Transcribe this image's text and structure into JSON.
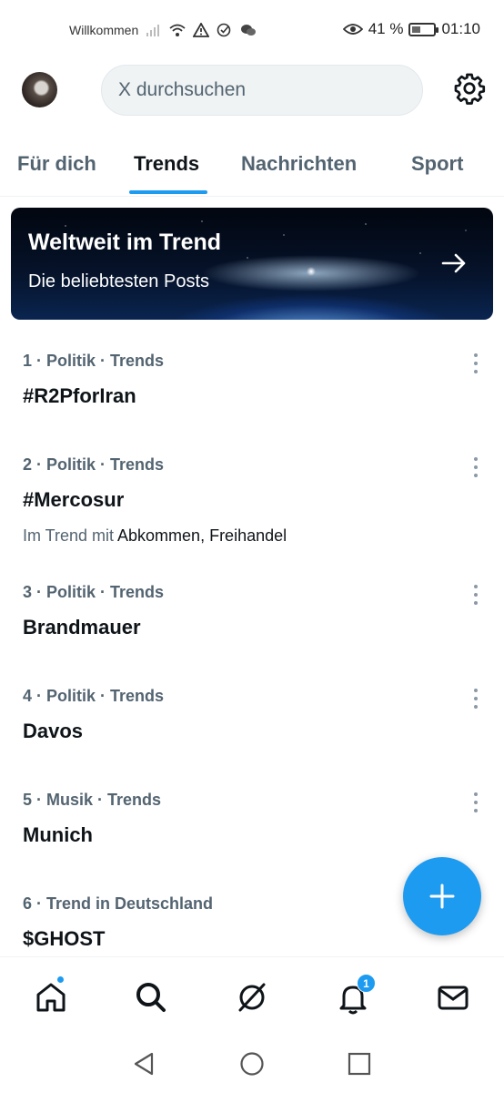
{
  "status_bar": {
    "carrier_text": "Willkommen",
    "battery_percent": "41 %",
    "battery_level": 0.41,
    "time": "01:10",
    "icons": [
      "signal-icon",
      "wifi-icon",
      "alert-icon",
      "check-circle-icon",
      "wechat-icon",
      "eye-icon",
      "battery-icon"
    ]
  },
  "header": {
    "search_placeholder": "X durchsuchen"
  },
  "tabs": [
    {
      "label": "Für dich",
      "active": false
    },
    {
      "label": "Trends",
      "active": true
    },
    {
      "label": "Nachrichten",
      "active": false
    },
    {
      "label": "Sport",
      "active": false
    }
  ],
  "banner": {
    "title": "Weltweit im Trend",
    "subtitle": "Die beliebtesten Posts"
  },
  "trends": [
    {
      "meta": "1 · Politik · Trends",
      "title": "#R2PforIran",
      "sub_prefix": "",
      "sub_words": ""
    },
    {
      "meta": "2 · Politik · Trends",
      "title": "#Mercosur",
      "sub_prefix": "Im Trend mit ",
      "sub_words": "Abkommen, Freihandel"
    },
    {
      "meta": "3 · Politik · Trends",
      "title": "Brandmauer",
      "sub_prefix": "",
      "sub_words": ""
    },
    {
      "meta": "4 · Politik · Trends",
      "title": "Davos",
      "sub_prefix": "",
      "sub_words": ""
    },
    {
      "meta": "5 · Musik · Trends",
      "title": "Munich",
      "sub_prefix": "",
      "sub_words": ""
    },
    {
      "meta": "6 · Trend in Deutschland",
      "title": "$GHOST",
      "sub_prefix": "",
      "sub_words": ""
    }
  ],
  "bottom_nav": {
    "items": [
      "home-icon",
      "search-icon",
      "grok-icon",
      "notifications-icon",
      "messages-icon"
    ],
    "notification_count": "1"
  },
  "colors": {
    "accent": "#1d9bf0",
    "text_primary": "#0f1419",
    "text_secondary": "#536471"
  }
}
